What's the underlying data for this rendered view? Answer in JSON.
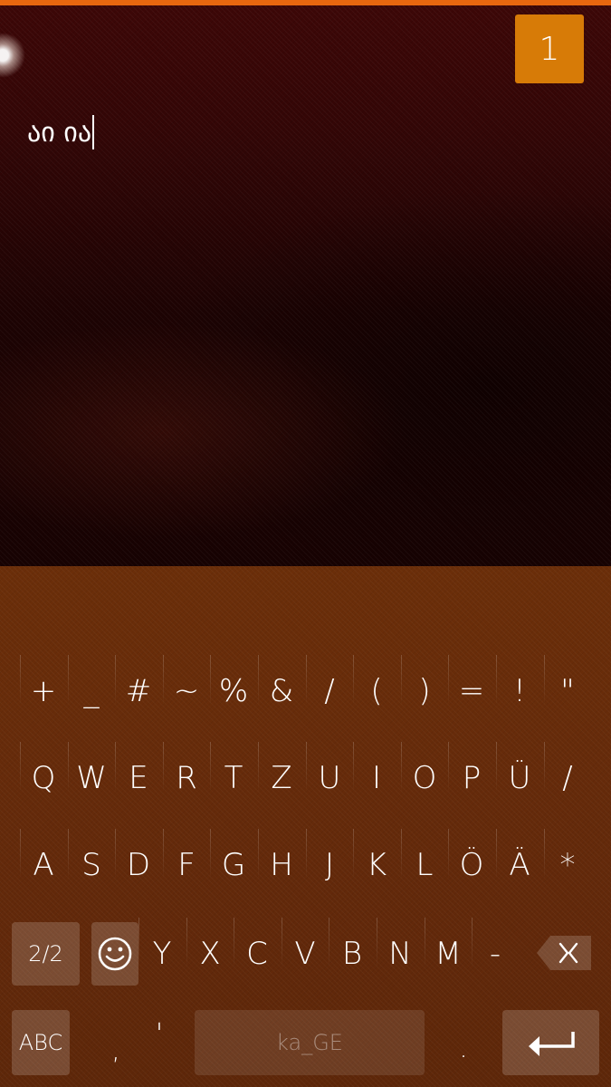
{
  "counter": "1",
  "input": {
    "text": "აი ია"
  },
  "keyboard": {
    "rows": [
      [
        "+",
        "_",
        "#",
        "~",
        "%",
        "&",
        "/",
        "(",
        ")",
        "=",
        "!",
        "\""
      ],
      [
        "Q",
        "W",
        "E",
        "R",
        "T",
        "Z",
        "U",
        "I",
        "O",
        "P",
        "Ü",
        "/"
      ],
      [
        "A",
        "S",
        "D",
        "F",
        "G",
        "H",
        "J",
        "K",
        "L",
        "Ö",
        "Ä",
        "*"
      ],
      [
        "Y",
        "X",
        "C",
        "V",
        "B",
        "N",
        "M",
        "-"
      ]
    ],
    "page_label": "2/2",
    "abc_label": "ABC",
    "comma": ",",
    "apostrophe": "'",
    "space_label": "ka_GE",
    "period": ".",
    "icons": {
      "emoji": "smiley-icon",
      "backspace": "backspace-icon",
      "enter": "enter-icon"
    }
  },
  "colors": {
    "accent": "#e8670f",
    "counter_bg": "#d77b07",
    "keyboard_bg": "#6b2e09"
  }
}
